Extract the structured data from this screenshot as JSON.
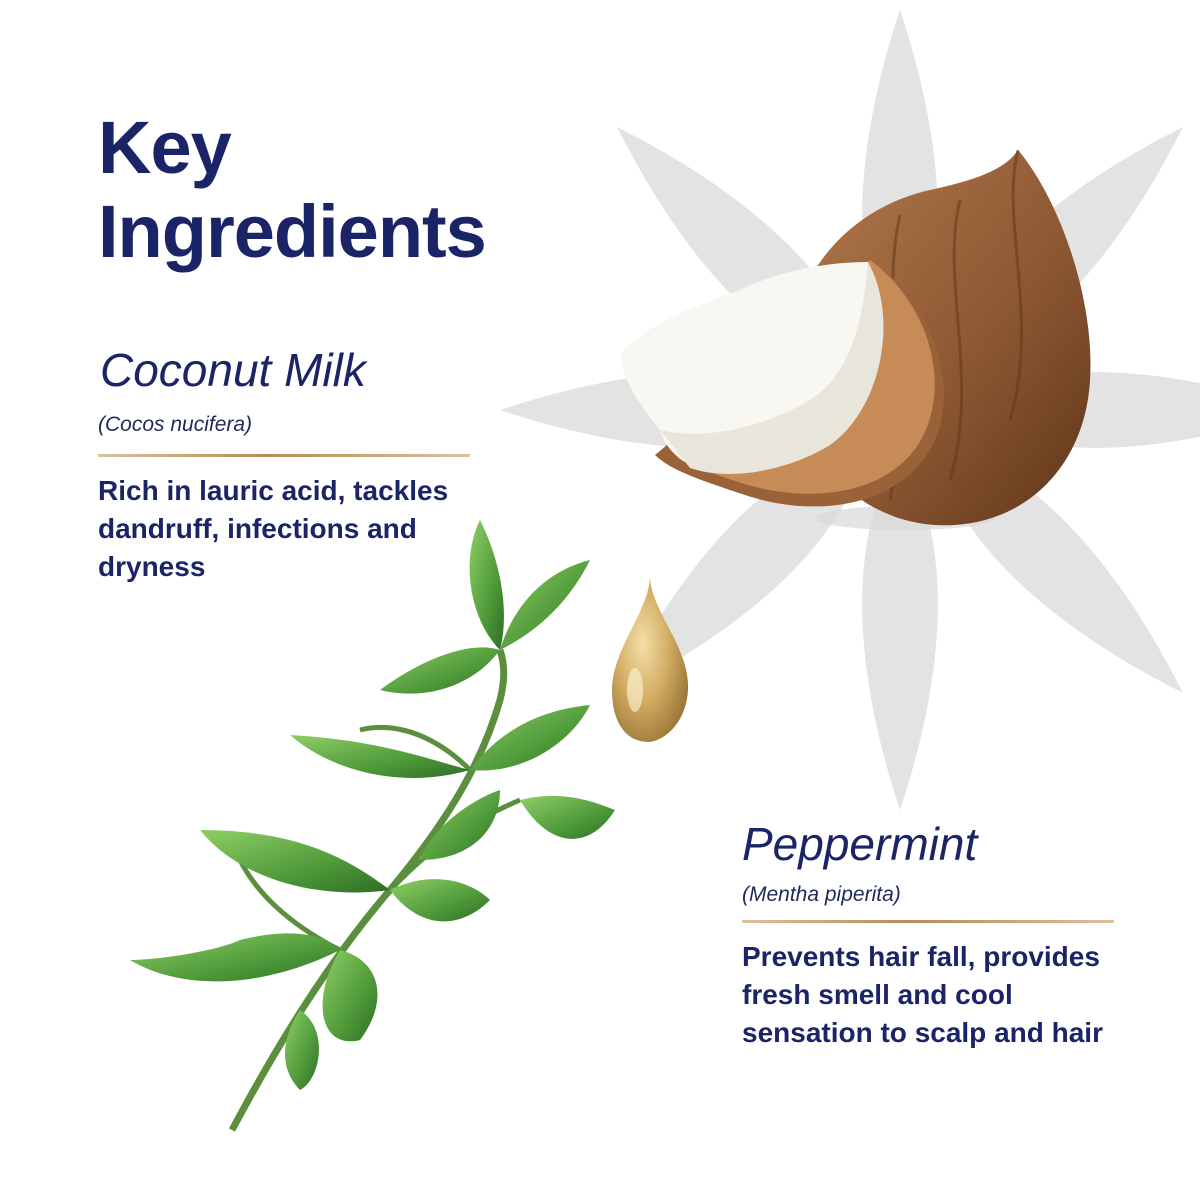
{
  "heading": {
    "line1": "Key",
    "line2": "Ingredients"
  },
  "ingredients": [
    {
      "name": "Coconut Milk",
      "latin": "(Cocos nucifera)",
      "description": "Rich in lauric acid, tackles dandruff, infections and dryness"
    },
    {
      "name": "Peppermint",
      "latin": "(Mentha piperita)",
      "description": "Prevents hair fall, provides fresh smell and cool sensation to scalp and hair"
    }
  ],
  "colors": {
    "text_navy": "#1b2466",
    "rule_gold": "#b98c55",
    "petal_grey": "#e3e3e3",
    "coconut_brown": "#8a5631",
    "mint_green": "#4f9a3a",
    "oil_gold": "#c9a35b"
  },
  "icons": [
    "flower-watermark-icon",
    "coconut-illustration",
    "oil-drop-illustration",
    "mint-sprig-illustration"
  ]
}
